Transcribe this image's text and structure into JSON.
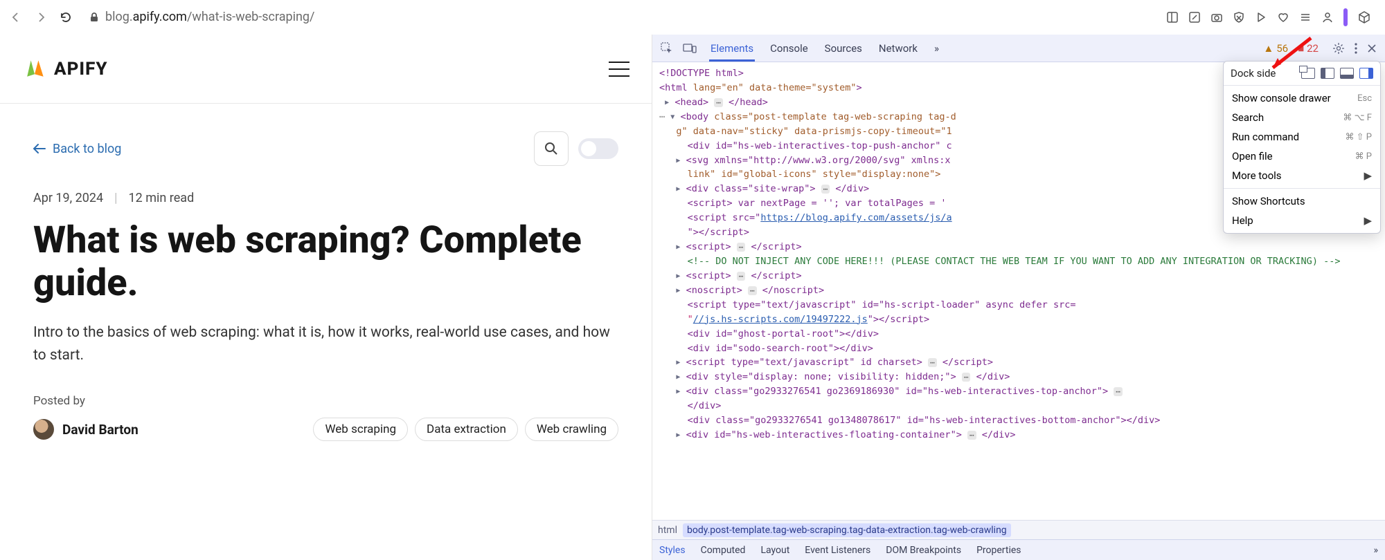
{
  "browser": {
    "url_prefix": "blog.",
    "url_domain": "apify.com",
    "url_path": "/what-is-web-scraping/"
  },
  "page": {
    "logo": "APIFY",
    "back_label": "Back to blog",
    "date": "Apr 19, 2024",
    "read_time": "12 min read",
    "title": "What is web scraping? Complete guide.",
    "subtitle": "Intro to the basics of web scraping: what it is, how it works, real-world use cases, and how to start.",
    "posted_by_label": "Posted by",
    "author": "David Barton",
    "tags": [
      "Web scraping",
      "Data extraction",
      "Web crawling"
    ]
  },
  "devtools": {
    "tabs": [
      "Elements",
      "Console",
      "Sources",
      "Network"
    ],
    "warn_count": "56",
    "info_count": "22",
    "menu": {
      "dock_label": "Dock side",
      "items": [
        {
          "label": "Show console drawer",
          "kbd": "Esc"
        },
        {
          "label": "Search",
          "kbd": "⌘ ⌥ F"
        },
        {
          "label": "Run command",
          "kbd": "⌘ ⇧ P"
        },
        {
          "label": "Open file",
          "kbd": "⌘ P"
        },
        {
          "label": "More tools",
          "sub": true
        }
      ],
      "items2": [
        {
          "label": "Show Shortcuts"
        },
        {
          "label": "Help",
          "sub": true
        }
      ]
    },
    "breadcrumb": {
      "html": "html",
      "body": "body.post-template.tag-web-scraping.tag-data-extraction.tag-web-crawling"
    },
    "bottom_tabs": [
      "Styles",
      "Computed",
      "Layout",
      "Event Listeners",
      "DOM Breakpoints",
      "Properties"
    ],
    "dom": {
      "doctype": "<!DOCTYPE html>",
      "html_open": {
        "attrs": " lang=\"en\" data-theme=\"system\""
      },
      "head": "<head>",
      "head_close": "</head>",
      "body_attrs1": " class=\"post-template tag-web-scraping tag-d",
      "body_attrs2": "g\" data-nav=\"sticky\" data-prismjs-copy-timeout=\"1",
      "l_div_push": "<div id=\"hs-web-interactives-top-push-anchor\" c",
      "l_svg": "<svg xmlns=\"http://www.w3.org/2000/svg\" xmlns:x",
      "l_link": "link\" id=\"global-icons\" style=\"display:none\">",
      "l_sitewrap": "<div class=\"site-wrap\">",
      "l_sitewrap_close": "</div>",
      "l_script1": "<script> var nextPage = ''; var totalPages = '",
      "l_script_src": "<script src=\"",
      "l_script_url": "https://blog.apify.com/assets/js/a",
      "l_script_close": "\"></script>",
      "l_script_empty": "<script>",
      "l_script_empty_close": "</script>",
      "l_comment": "<!-- DO NOT INJECT ANY CODE HERE!!! (PLEASE CONTACT THE WEB TEAM IF YOU WANT TO ADD ANY INTEGRATION OR TRACKING) -->",
      "l_noscript": "<noscript>",
      "l_noscript_close": "</noscript>",
      "l_hsscript_a": "<script type=\"text/javascript\" id=\"hs-script-loader\" async defer src=",
      "l_hsscript_url": "//js.hs-scripts.com/19497222.js",
      "l_hsscript_b": "\"></script>",
      "l_ghost": "<div id=\"ghost-portal-root\"></div>",
      "l_sodo": "<div id=\"sodo-search-root\"></div>",
      "l_charset": "<script type=\"text/javascript\" id charset>",
      "l_charset_close": "</script>",
      "l_hidden": "<div style=\"display: none; visibility: hidden;\">",
      "l_hidden_close": "</div>",
      "l_go1": "<div class=\"go2933276541 go2369186930\" id=\"hs-web-interactives-top-anchor\">",
      "l_go1_close": "</div>",
      "l_go2": "<div class=\"go2933276541 go1348078617\" id=\"hs-web-interactives-bottom-anchor\"></div>",
      "l_float": "<div id=\"hs-web-interactives-floating-container\">",
      "l_float_close": "</div>"
    }
  }
}
